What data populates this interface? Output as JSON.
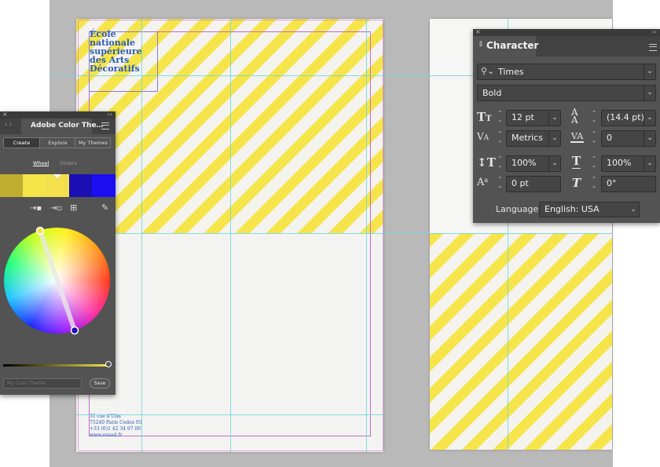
{
  "document": {
    "logo_text": "École\nnationale\nsupérieure\ndes Arts\nDécoratifs",
    "address_text": "31 rue d'Ulm\n75240 Paris Cedex 05\n+33 (0)1 42 34 97 00\nwww.ensad.fr"
  },
  "color_panel": {
    "title": "Adobe Color The…",
    "tabs": [
      "Create",
      "Explore",
      "My Themes"
    ],
    "subtabs": [
      "Wheel",
      "Sliders"
    ],
    "swatches": [
      "#bfae2f",
      "#f5e44a",
      "#f3e04c",
      "#1a0fb3",
      "#1b0ef0"
    ],
    "theme_name_placeholder": "My Color Theme",
    "save_label": "Save",
    "brightness_level": 1.0
  },
  "character_panel": {
    "title": "Character",
    "font_family": "Times",
    "font_style": "Bold",
    "font_size": "12 pt",
    "leading": "(14.4 pt)",
    "kerning": "Metrics",
    "tracking": "0",
    "vertical_scale": "100%",
    "horizontal_scale": "100%",
    "baseline_shift": "0 pt",
    "skew": "0°",
    "language_label": "Language:",
    "language": "English: USA"
  },
  "colors": {
    "stripe_yellow": "#f6e54a",
    "panel_bg": "#535353",
    "guide": "#6fd6e0",
    "margin": "#c46ad0",
    "brand_blue": "#2a5bb6"
  },
  "icons": [
    "close-icon",
    "collapse-icon",
    "panel-menu-icon",
    "search-icon",
    "font-size-icon",
    "leading-icon",
    "kerning-icon",
    "tracking-icon",
    "vertical-scale-icon",
    "horizontal-scale-icon",
    "baseline-shift-icon",
    "skew-icon",
    "color-wheel-icon",
    "eyedropper-icon"
  ]
}
